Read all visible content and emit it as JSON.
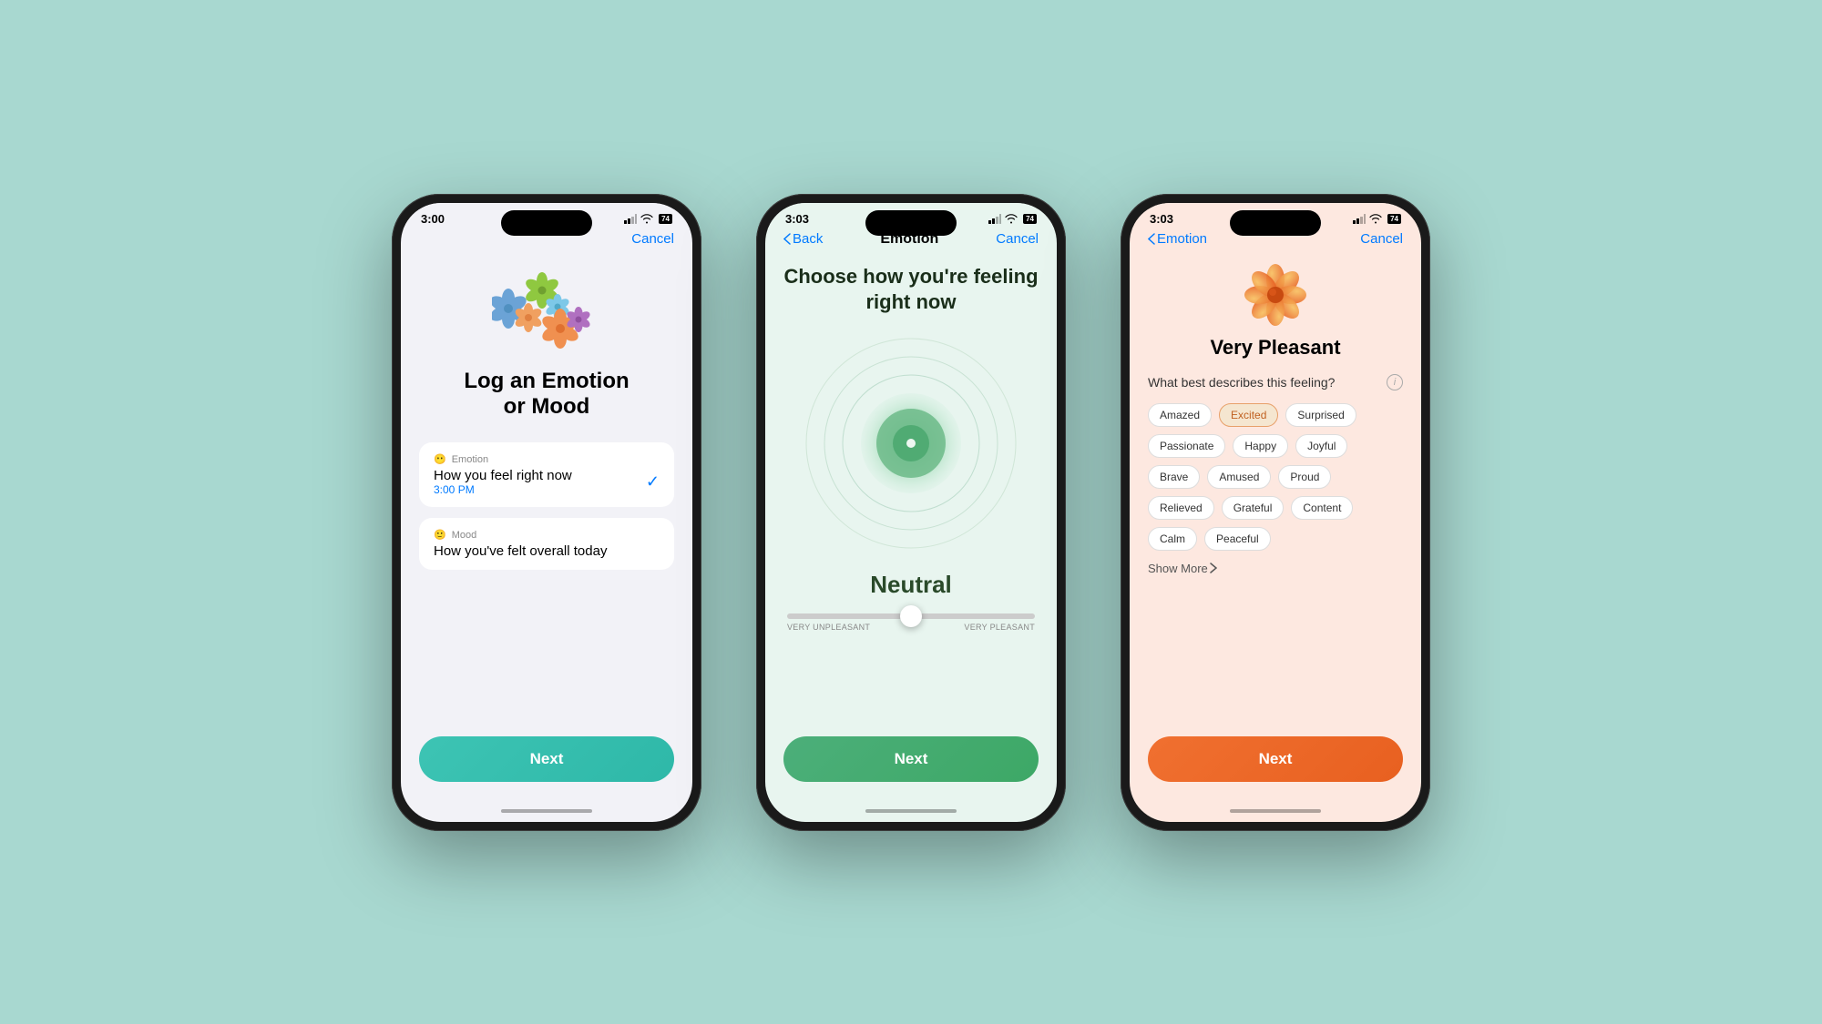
{
  "background_color": "#a8d8d0",
  "phone1": {
    "status_time": "3:00",
    "battery": "74",
    "nav_cancel": "Cancel",
    "title_line1": "Log an Emotion",
    "title_line2": "or Mood",
    "emotion_option": {
      "icon": "emotion-icon",
      "label": "Emotion",
      "description": "How you feel right now",
      "time": "3:00 PM",
      "selected": true
    },
    "mood_option": {
      "icon": "mood-icon",
      "label": "Mood",
      "description": "How you've felt overall today"
    },
    "next_button": "Next",
    "button_color": "#3dc4b4"
  },
  "phone2": {
    "status_time": "3:03",
    "battery": "74",
    "nav_back": "Back",
    "nav_title": "Emotion",
    "nav_cancel": "Cancel",
    "heading": "Choose how you're feeling right now",
    "emotion_value": "Neutral",
    "slider_left": "VERY UNPLEASANT",
    "slider_right": "VERY PLEASANT",
    "next_button": "Next",
    "button_color": "#4caf7a"
  },
  "phone3": {
    "status_time": "3:03",
    "battery": "74",
    "nav_back": "Emotion",
    "nav_cancel": "Cancel",
    "feeling_label": "Very Pleasant",
    "question": "What best describes this feeling?",
    "tags": [
      {
        "label": "Amazed",
        "selected": false
      },
      {
        "label": "Excited",
        "selected": true
      },
      {
        "label": "Surprised",
        "selected": false
      },
      {
        "label": "Passionate",
        "selected": false
      },
      {
        "label": "Happy",
        "selected": false
      },
      {
        "label": "Joyful",
        "selected": false
      },
      {
        "label": "Brave",
        "selected": false
      },
      {
        "label": "Amused",
        "selected": false
      },
      {
        "label": "Proud",
        "selected": false
      },
      {
        "label": "Relieved",
        "selected": false
      },
      {
        "label": "Grateful",
        "selected": false
      },
      {
        "label": "Content",
        "selected": false
      },
      {
        "label": "Calm",
        "selected": false
      },
      {
        "label": "Peaceful",
        "selected": false
      }
    ],
    "show_more": "Show More",
    "next_button": "Next",
    "button_color": "#f07030"
  }
}
